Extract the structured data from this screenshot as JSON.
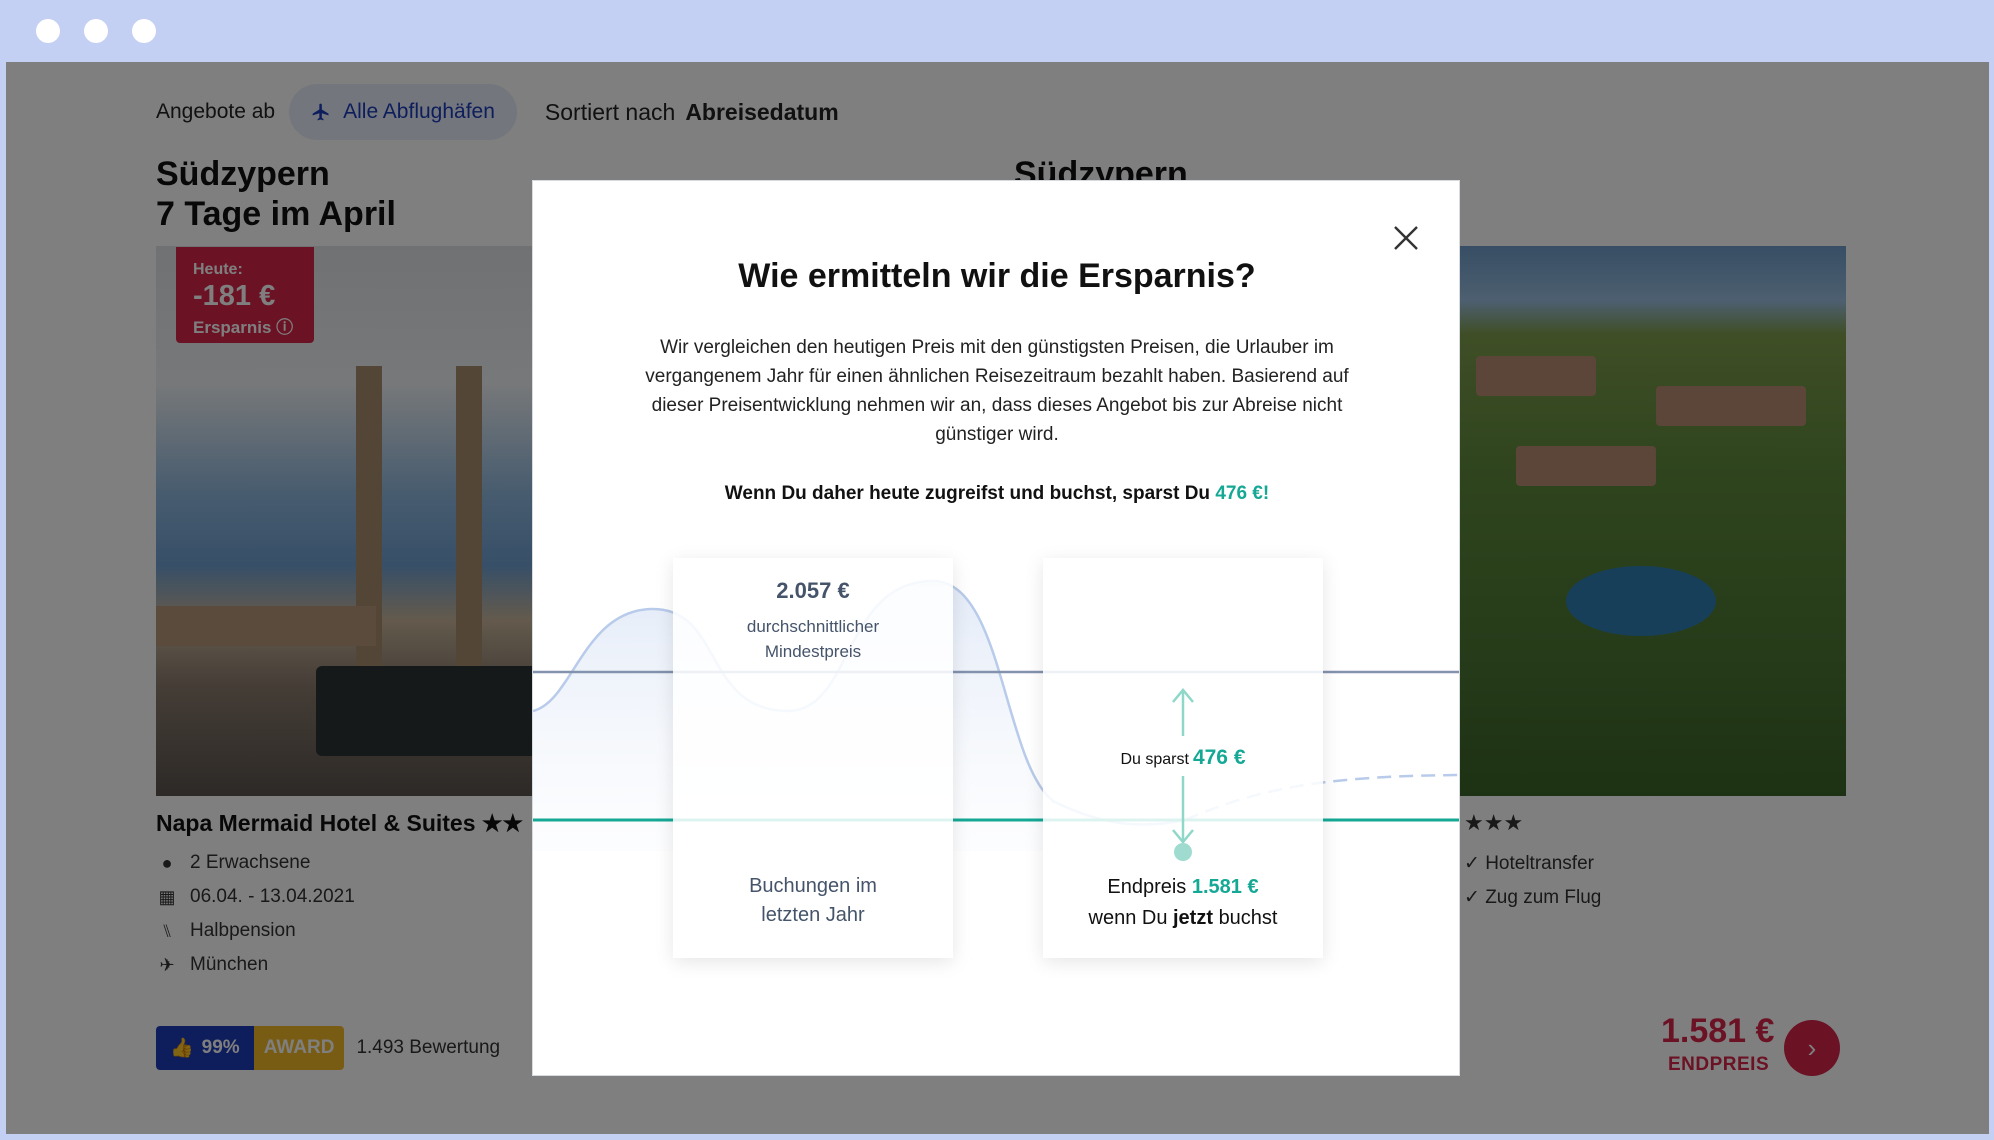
{
  "browser": {
    "dots": [
      "window-dot-1",
      "window-dot-2",
      "window-dot-3"
    ]
  },
  "toolbar": {
    "offers_from": "Angebote ab",
    "airport_chip": "Alle Abflughäfen",
    "sort_label": "Sortiert nach",
    "sort_value": "Abreisedatum"
  },
  "card_left": {
    "title_line1": "Südzypern",
    "title_line2": "7 Tage im April",
    "badge_today": "Heute:",
    "badge_amount": "-181 €",
    "badge_savings": "Ersparnis",
    "hotel": "Napa Mermaid Hotel & Suites",
    "stars": "★★",
    "adults": "2 Erwachsene",
    "dates": "06.04. - 13.04.2021",
    "board": "Halbpension",
    "airport": "München",
    "rating_percent": "99%",
    "award": "AWARD",
    "reviews": "1.493 Bewertung"
  },
  "card_right": {
    "title_line1": "Südzypern",
    "stars": "★★★",
    "feature1": "Hoteltransfer",
    "feature2": "Zug zum Flug",
    "price": "1.581 €",
    "price_label": "ENDPREIS"
  },
  "modal": {
    "title": "Wie ermitteln wir die Ersparnis?",
    "text": "Wir vergleichen den heutigen Preis mit den günstigsten Preisen, die Urlauber im vergangenem Jahr für einen ähnlichen Reisezeitraum bezahlt haben. Basierend auf dieser Preisentwicklung nehmen wir an, dass dieses Angebot bis zur Abreise nicht günstiger wird.",
    "cta_prefix": "Wenn Du daher heute zugreifst und buchst, sparst Du",
    "cta_amount": "476 €!",
    "left_price": "2.057 €",
    "left_sub_line1": "durchschnittlicher",
    "left_sub_line2": "Mindestpreis",
    "left_foot_line1": "Buchungen im",
    "left_foot_line2": "letzten Jahr",
    "save_prefix": "Du sparst",
    "save_amount": "476 €",
    "final_prefix": "Endpreis",
    "final_amount": "1.581 €",
    "when_prefix": "wenn Du",
    "when_bold": "jetzt",
    "when_suffix": "buchst"
  },
  "colors": {
    "accent_teal": "#14a895",
    "brand_red": "#d6254b",
    "brand_blue": "#1d3db8",
    "award_gold": "#f3b928",
    "titlebar": "#c3cff3"
  }
}
